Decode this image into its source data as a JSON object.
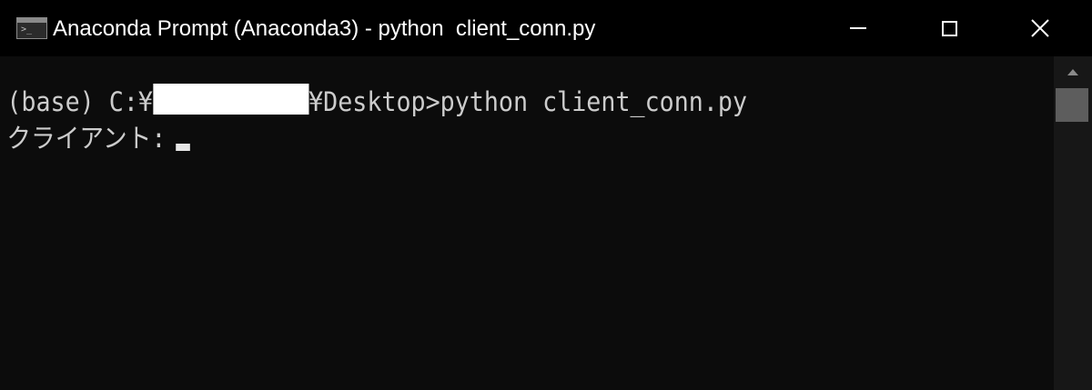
{
  "window": {
    "title": "Anaconda Prompt (Anaconda3) - python  client_conn.py",
    "app_icon": "console-icon"
  },
  "controls": {
    "minimize": "minimize-icon",
    "maximize": "maximize-icon",
    "close_label": "✕"
  },
  "console": {
    "line1_prefix": "(base) C:¥",
    "line1_suffix": "¥Desktop>python client_conn.py",
    "line2_prompt": "クライアント:"
  },
  "colors": {
    "background": "#0c0c0c",
    "text": "#cccccc",
    "titlebar": "#000000"
  }
}
